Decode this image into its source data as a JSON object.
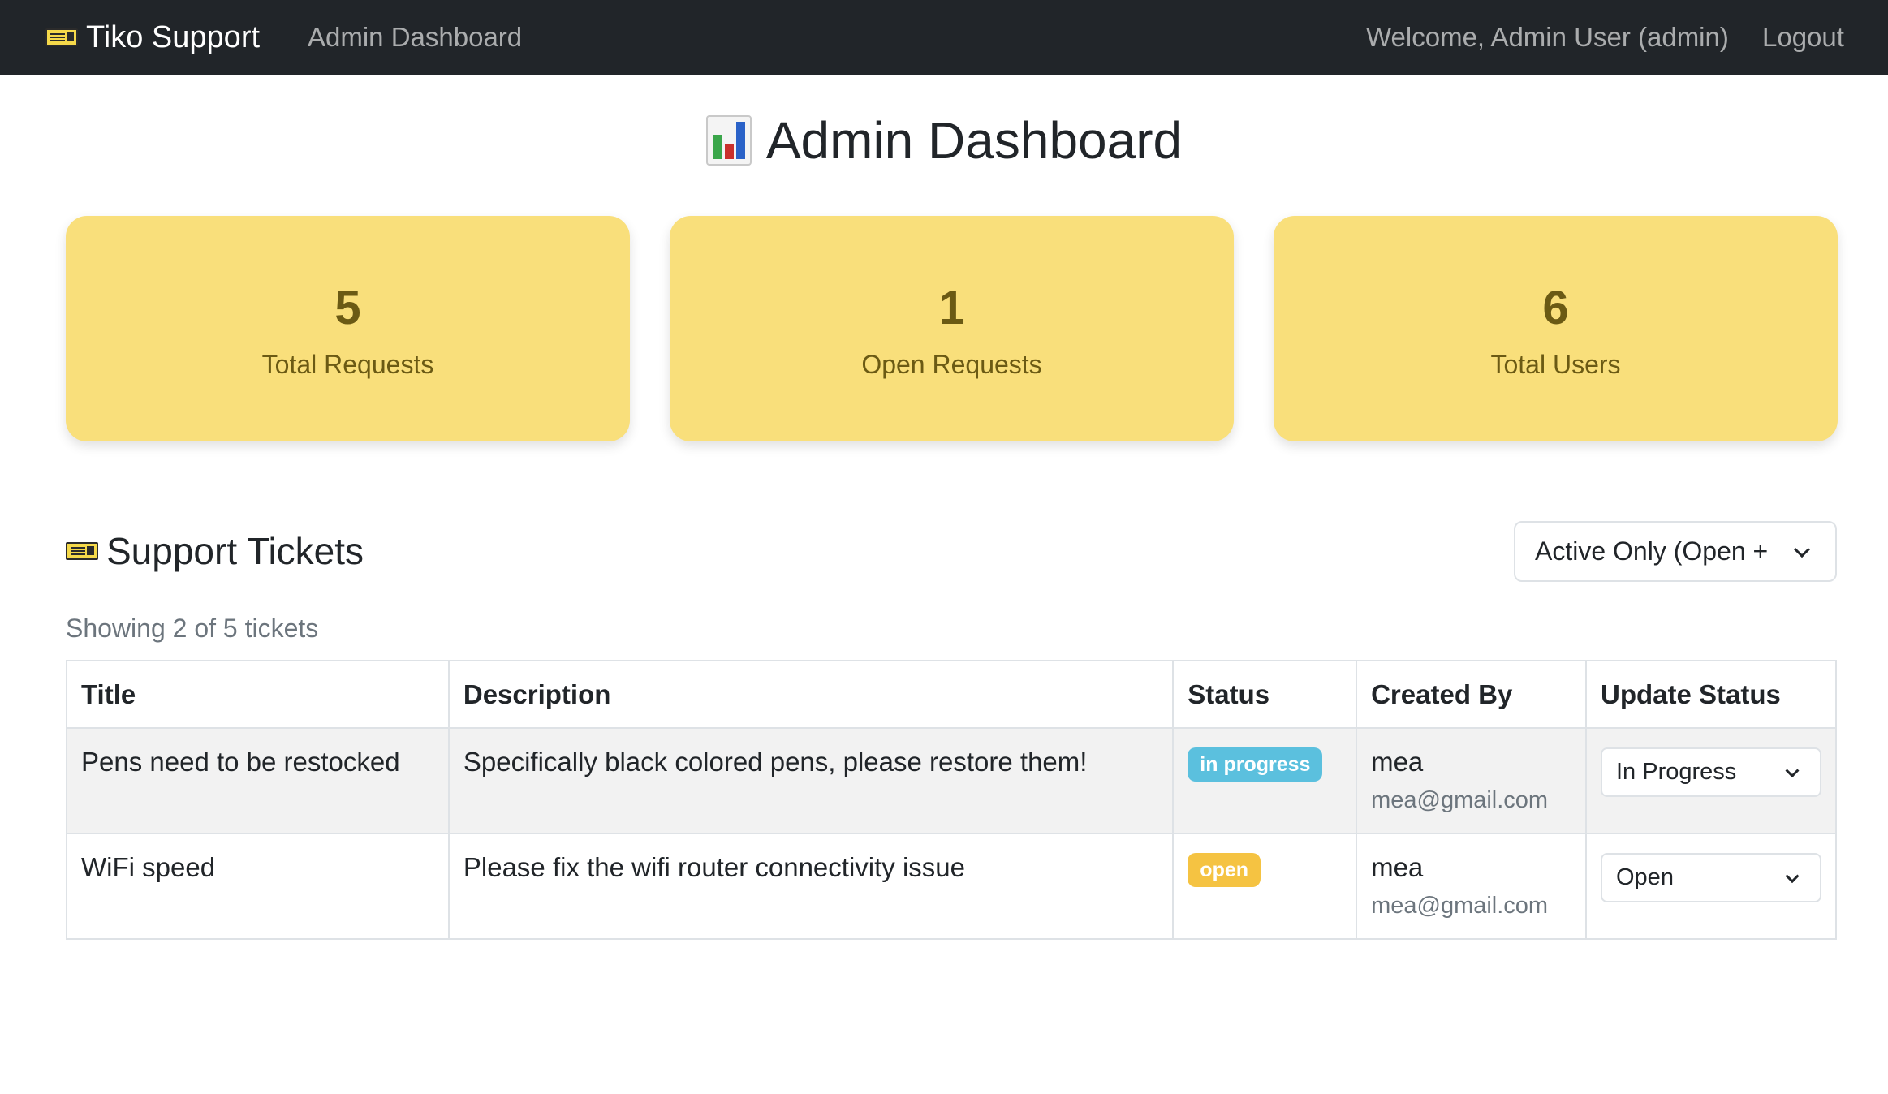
{
  "navbar": {
    "brand": "Tiko Support",
    "admin_link": "Admin Dashboard",
    "welcome": "Welcome, Admin User (admin)",
    "logout": "Logout"
  },
  "page": {
    "title": "Admin Dashboard"
  },
  "stats": [
    {
      "value": "5",
      "label": "Total Requests"
    },
    {
      "value": "1",
      "label": "Open Requests"
    },
    {
      "value": "6",
      "label": "Total Users"
    }
  ],
  "tickets": {
    "title": "Support Tickets",
    "filter_value": "Active Only (Open +",
    "showing": "Showing 2 of 5 tickets",
    "columns": [
      "Title",
      "Description",
      "Status",
      "Created By",
      "Update Status"
    ],
    "rows": [
      {
        "title": "Pens need to be restocked",
        "description": "Specifically black colored pens, please restore them!",
        "status": "in progress",
        "created_by_name": "mea",
        "created_by_email": "mea@gmail.com",
        "update_status": "In Progress"
      },
      {
        "title": "WiFi speed",
        "description": "Please fix the wifi router connectivity issue",
        "status": "open",
        "created_by_name": "mea",
        "created_by_email": "mea@gmail.com",
        "update_status": "Open"
      }
    ]
  },
  "colors": {
    "navbar_bg": "#212529",
    "card_bg": "#f9df7b",
    "card_text": "#6b5a14",
    "badge_in_progress": "#5bc0de",
    "badge_open": "#f5c342"
  },
  "icons": {
    "brand_icon": "ticket-icon",
    "title_icon": "bar-chart-icon",
    "section_icon": "ticket-icon"
  }
}
